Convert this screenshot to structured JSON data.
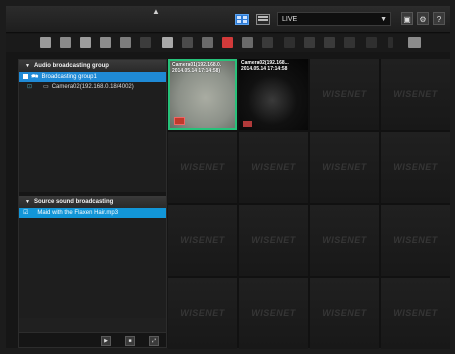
{
  "topbar": {
    "mode_select": "LIVE",
    "window_buttons": [
      "▣",
      "⚙",
      "?"
    ]
  },
  "toolbar": {
    "icons": [
      "layout-grid-icon",
      "split-view-icon",
      "image-icon",
      "camera-icon",
      "sequence-icon",
      "shield-icon",
      "lock-icon",
      "archive-icon",
      "print-icon",
      "record-icon",
      "capture-icon",
      "audio-icon",
      "ptz-icon",
      "zoom-in-icon",
      "zoom-out-icon",
      "zoom-reset-icon",
      "sun-icon",
      "info-icon",
      "keyboard-icon"
    ]
  },
  "left_panel": {
    "audio_section": {
      "title": "Audio broadcasting group",
      "items": [
        {
          "label": "Broadcasting group1",
          "selected": true
        },
        {
          "label": "Camera02(192.168.0.18/4002)",
          "selected": false
        }
      ]
    },
    "sound_section": {
      "title": "Source sound broadcasting",
      "items": [
        {
          "label": "Maid with the Flaxen Hair.mp3",
          "selected": true
        }
      ]
    },
    "controls": [
      "▶",
      "■",
      "⤢"
    ]
  },
  "video_grid": {
    "watermark": "WISENET",
    "cameras": [
      {
        "label": "Camera01(192.168.0.\n2014.05.14 17:14:58)"
      },
      {
        "label": "Camera02(192.168...\n2014.05.14 17:14:58"
      }
    ]
  }
}
